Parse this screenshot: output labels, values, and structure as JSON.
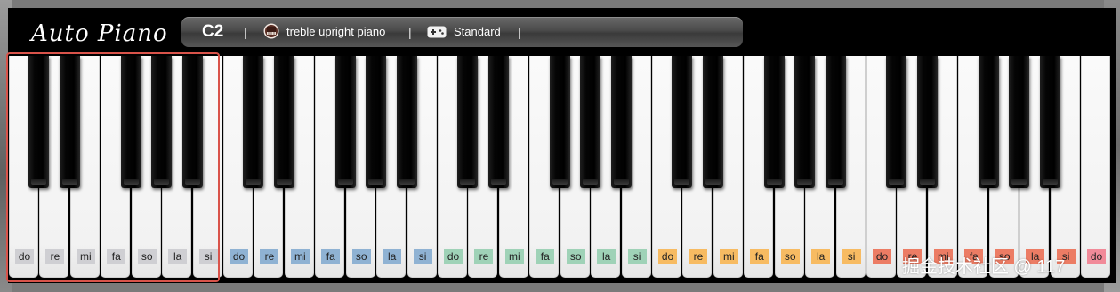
{
  "app": {
    "logo": "Auto Piano",
    "current_note": "C2",
    "separator": "|",
    "instrument": "treble upright piano",
    "instrument_icon": "piano-thumbnail-icon",
    "mode": "Standard",
    "mode_icon": "gamepad-icon"
  },
  "keyboard": {
    "white_keys": [
      {
        "label": "do",
        "color": "gray"
      },
      {
        "label": "re",
        "color": "gray"
      },
      {
        "label": "mi",
        "color": "gray"
      },
      {
        "label": "fa",
        "color": "gray"
      },
      {
        "label": "so",
        "color": "gray"
      },
      {
        "label": "la",
        "color": "gray"
      },
      {
        "label": "si",
        "color": "gray"
      },
      {
        "label": "do",
        "color": "blue"
      },
      {
        "label": "re",
        "color": "blue"
      },
      {
        "label": "mi",
        "color": "blue"
      },
      {
        "label": "fa",
        "color": "blue"
      },
      {
        "label": "so",
        "color": "blue"
      },
      {
        "label": "la",
        "color": "blue"
      },
      {
        "label": "si",
        "color": "blue"
      },
      {
        "label": "do",
        "color": "green"
      },
      {
        "label": "re",
        "color": "green"
      },
      {
        "label": "mi",
        "color": "green"
      },
      {
        "label": "fa",
        "color": "green"
      },
      {
        "label": "so",
        "color": "green"
      },
      {
        "label": "la",
        "color": "green"
      },
      {
        "label": "si",
        "color": "green"
      },
      {
        "label": "do",
        "color": "orange"
      },
      {
        "label": "re",
        "color": "orange"
      },
      {
        "label": "mi",
        "color": "orange"
      },
      {
        "label": "fa",
        "color": "orange"
      },
      {
        "label": "so",
        "color": "orange"
      },
      {
        "label": "la",
        "color": "orange"
      },
      {
        "label": "si",
        "color": "orange"
      },
      {
        "label": "do",
        "color": "red"
      },
      {
        "label": "re",
        "color": "red"
      },
      {
        "label": "mi",
        "color": "red"
      },
      {
        "label": "fa",
        "color": "red"
      },
      {
        "label": "so",
        "color": "red"
      },
      {
        "label": "la",
        "color": "red"
      },
      {
        "label": "si",
        "color": "red"
      },
      {
        "label": "do",
        "color": "pink"
      }
    ],
    "black_keys_per_octave": 5,
    "octaves": 5,
    "highlighted_octave": 1
  },
  "watermark": "掘金技术社区 @ 117",
  "colors": {
    "gray": "#cfcfd3",
    "blue": "#8fb2d3",
    "green": "#9fd2b7",
    "orange": "#f7bb62",
    "red": "#ec7c64",
    "pink": "#f18a99",
    "selection": "#d9534a"
  }
}
